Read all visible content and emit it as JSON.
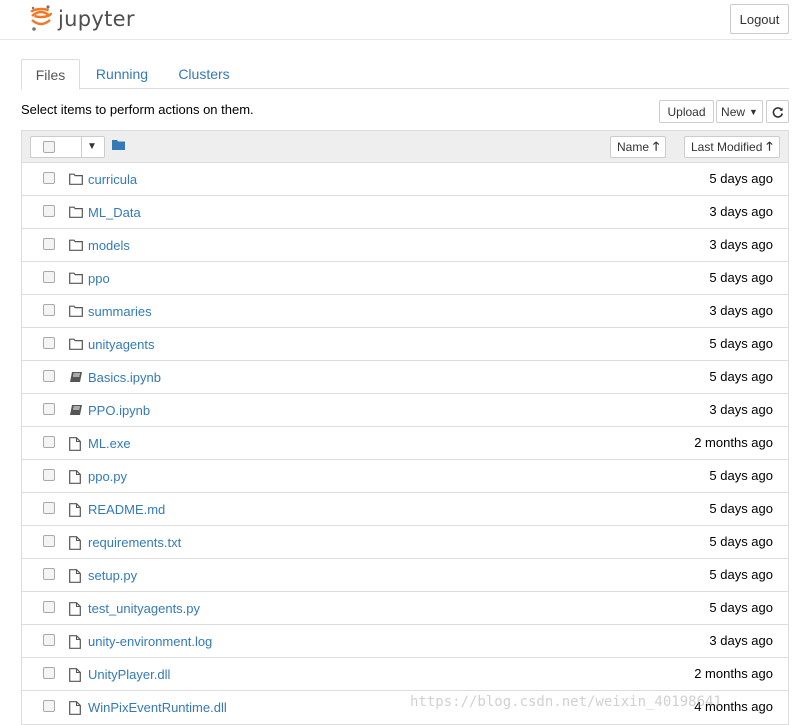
{
  "app": {
    "logo_text": "jupyter",
    "logout_label": "Logout"
  },
  "tabs": [
    {
      "label": "Files",
      "active": true
    },
    {
      "label": "Running",
      "active": false
    },
    {
      "label": "Clusters",
      "active": false
    }
  ],
  "toolbar": {
    "hint": "Select items to perform actions on them.",
    "upload_label": "Upload",
    "new_label": "New",
    "refresh_icon": "refresh-icon"
  },
  "list_header": {
    "folder_icon": "folder-icon",
    "sort_name_label": "Name",
    "sort_modified_label": "Last Modified"
  },
  "files": [
    {
      "name": "curricula",
      "type": "folder",
      "modified": "5 days ago"
    },
    {
      "name": "ML_Data",
      "type": "folder",
      "modified": "3 days ago"
    },
    {
      "name": "models",
      "type": "folder",
      "modified": "3 days ago"
    },
    {
      "name": "ppo",
      "type": "folder",
      "modified": "5 days ago"
    },
    {
      "name": "summaries",
      "type": "folder",
      "modified": "3 days ago"
    },
    {
      "name": "unityagents",
      "type": "folder",
      "modified": "5 days ago"
    },
    {
      "name": "Basics.ipynb",
      "type": "notebook",
      "modified": "5 days ago"
    },
    {
      "name": "PPO.ipynb",
      "type": "notebook",
      "modified": "3 days ago"
    },
    {
      "name": "ML.exe",
      "type": "file",
      "modified": "2 months ago"
    },
    {
      "name": "ppo.py",
      "type": "file",
      "modified": "5 days ago"
    },
    {
      "name": "README.md",
      "type": "file",
      "modified": "5 days ago"
    },
    {
      "name": "requirements.txt",
      "type": "file",
      "modified": "5 days ago"
    },
    {
      "name": "setup.py",
      "type": "file",
      "modified": "5 days ago"
    },
    {
      "name": "test_unityagents.py",
      "type": "file",
      "modified": "5 days ago"
    },
    {
      "name": "unity-environment.log",
      "type": "file",
      "modified": "3 days ago"
    },
    {
      "name": "UnityPlayer.dll",
      "type": "file",
      "modified": "2 months ago"
    },
    {
      "name": "WinPixEventRuntime.dll",
      "type": "file",
      "modified": "4 months ago"
    }
  ],
  "watermark": "https://blog.csdn.net/weixin_40198641",
  "colors": {
    "link": "#337ab7",
    "logo_orange": "#f37726"
  }
}
